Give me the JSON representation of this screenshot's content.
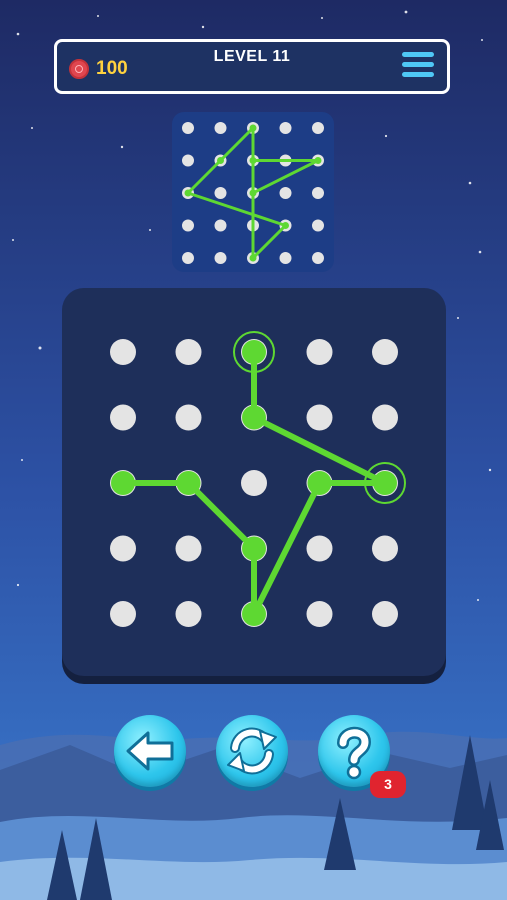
{
  "header": {
    "coins": "100",
    "level_title": "LEVEL 11"
  },
  "hint": {
    "count": "3"
  },
  "colors": {
    "line": "#5ed832",
    "dot": "#e4e4e4",
    "board": "#1e2f5a",
    "target_panel": "#1d3d86",
    "button": "#2ec6ec",
    "badge": "#e0242f",
    "coin_text": "#ffd23f"
  },
  "icons": {
    "coin": "coin-icon",
    "menu": "menu-icon",
    "back": "arrow-left-icon",
    "restart": "refresh-icon",
    "hint": "question-icon"
  },
  "puzzle": {
    "grid_size": 5,
    "target_path": [
      [
        2,
        0
      ],
      [
        2,
        2
      ],
      [
        4,
        1
      ],
      [
        2,
        1
      ],
      [
        2,
        4
      ],
      [
        3,
        3
      ],
      [
        0,
        2
      ],
      [
        1,
        1
      ],
      [
        2,
        0
      ]
    ],
    "drawn_path": [
      [
        2,
        0
      ],
      [
        2,
        1
      ],
      [
        4,
        2
      ],
      [
        3,
        2
      ],
      [
        2,
        4
      ],
      [
        2,
        3
      ],
      [
        1,
        2
      ],
      [
        0,
        2
      ],
      [
        1,
        2
      ],
      [
        2,
        3
      ],
      [
        2,
        4
      ],
      [
        3,
        2
      ],
      [
        4,
        2
      ],
      [
        2,
        1
      ],
      [
        2,
        0
      ]
    ]
  }
}
